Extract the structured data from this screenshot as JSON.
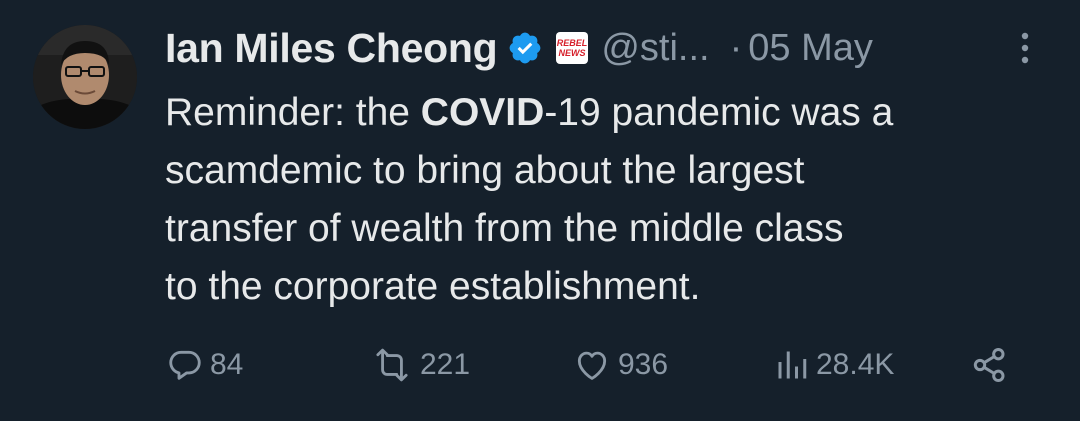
{
  "author": {
    "name": "Ian Miles Cheong",
    "handle": "@sti...",
    "affiliate_badge_text_top": "REBEL",
    "affiliate_badge_text_bottom": "NEWS",
    "verified": true
  },
  "meta": {
    "separator": "·",
    "date": "05 May"
  },
  "tweet": {
    "line1_a": "Reminder: the ",
    "line1_bold": "COVID",
    "line1_b": "-19 pandemic was a",
    "line2": "scamdemic to bring about the largest",
    "line3": "transfer of wealth from the middle class",
    "line4": "to the corporate establishment."
  },
  "actions": {
    "replies": "84",
    "reposts": "221",
    "likes": "936",
    "views": "28.4K"
  },
  "icons": {
    "verified": "verified-badge-icon",
    "affiliate": "rebel-news-badge-icon",
    "more": "more-options-icon",
    "reply": "reply-icon",
    "repost": "repost-icon",
    "like": "like-icon",
    "views": "views-icon",
    "share": "share-icon"
  },
  "colors": {
    "background": "#15202b",
    "text": "#e7e9ea",
    "secondary": "#8b98a5",
    "verified_blue": "#1d9bf0",
    "rebel_red": "#d6202b"
  }
}
